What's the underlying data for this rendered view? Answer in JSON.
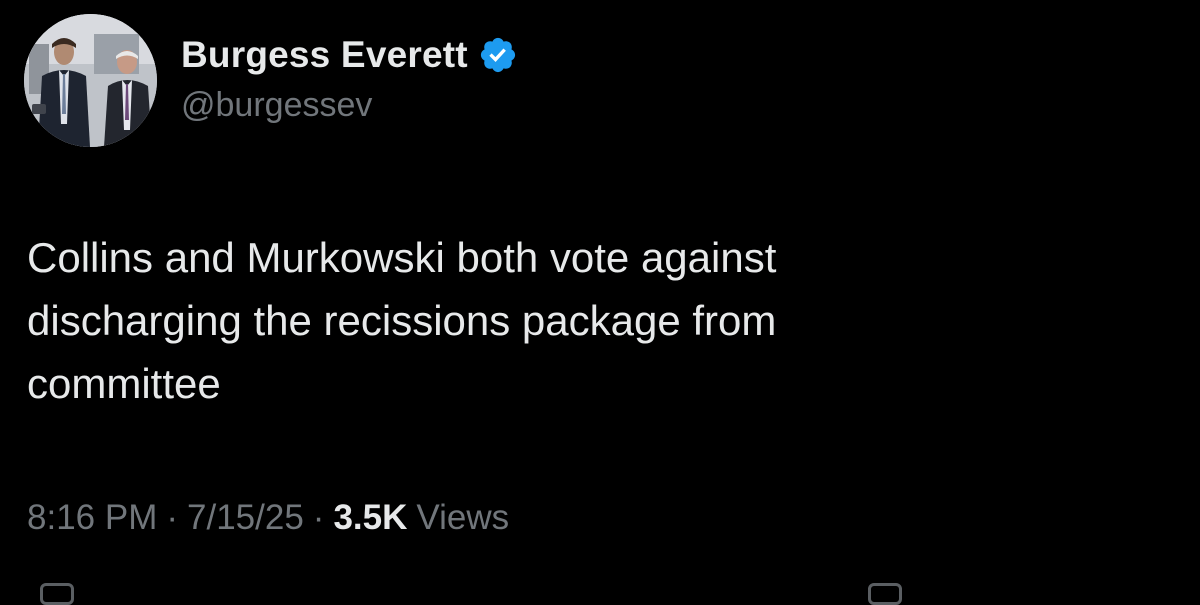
{
  "tweet": {
    "author": {
      "display_name": "Burgess Everett",
      "handle": "@burgessev",
      "verified": true
    },
    "text_lines": [
      "Collins and Murkowski both vote against",
      "discharging the recissions package from",
      "committee"
    ],
    "meta": {
      "time": "8:16 PM",
      "separator": "·",
      "date": "7/15/25",
      "views_count": "3.5K",
      "views_label": "Views"
    }
  },
  "colors": {
    "background": "#000000",
    "primary_text": "#e7e9ea",
    "secondary_text": "#71767b",
    "verified_badge": "#1d9bf0"
  },
  "icons": {
    "verified": "verified-badge-icon",
    "avatar": "profile-photo"
  }
}
